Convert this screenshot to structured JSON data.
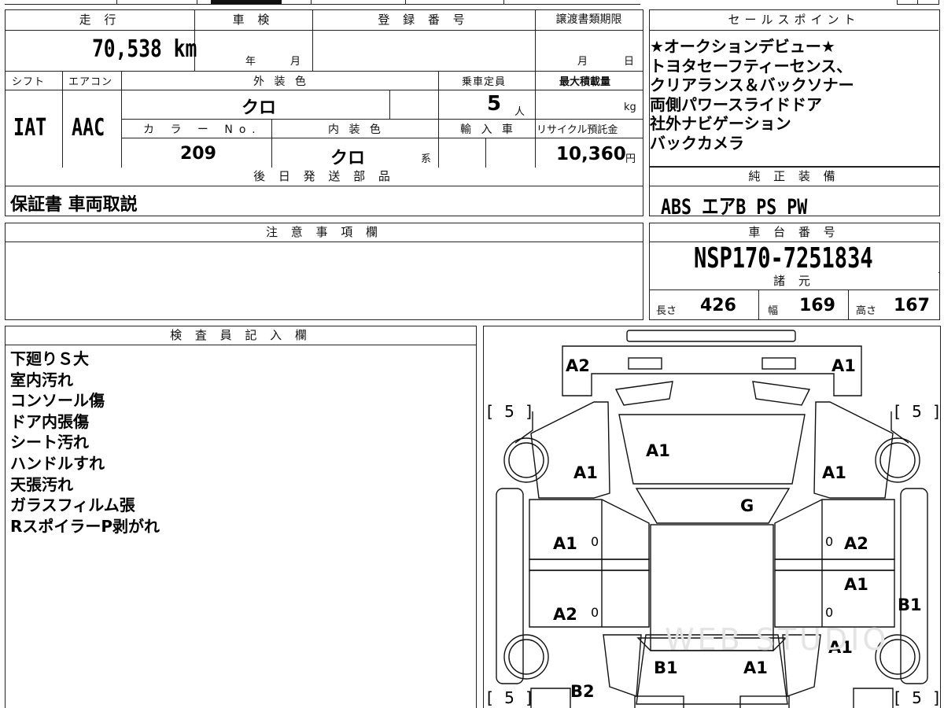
{
  "header": {
    "mileage_label": "走 行",
    "mileage_value": "70,538 km",
    "shaken_label": "車 検",
    "shaken_year": "年",
    "shaken_month": "月",
    "registration_label": "登 録 番 号",
    "transfer_label": "譲渡書類期限",
    "transfer_month": "月",
    "transfer_day": "日",
    "shift_label": "シフト",
    "shift_value": "IAT",
    "aircon_label": "エアコン",
    "aircon_value": "AAC",
    "exterior_label": "外 装 色",
    "exterior_value": "クロ",
    "capacity_label": "乗車定員",
    "capacity_value": "5",
    "capacity_unit": "人",
    "maxload_label": "最大積載量",
    "maxload_unit": "kg",
    "colorno_label": "カ ラ ー No.",
    "colorno_value": "209",
    "interior_label": "内 装 色",
    "interior_value": "クロ",
    "interior_suffix": "系",
    "import_label": "輸 入 車",
    "recycle_label": "リサイクル預託金",
    "recycle_value": "10,360",
    "recycle_unit": "円",
    "later_label": "後 日 発 送 部 品",
    "later_value": "保証書 車両取説"
  },
  "sales": {
    "label": "セールスポイント",
    "lines": [
      "★オークションデビュー★",
      "トヨタセーフティーセンス、",
      "クリアランス＆バックソナー",
      "両側パワースライドドア",
      "社外ナビゲーション",
      "バックカメラ"
    ]
  },
  "equipment": {
    "label": "純 正 装 備",
    "value": "ABS エアB PS PW"
  },
  "caution": {
    "label": "注 意 事 項 欄"
  },
  "chassis": {
    "label": "車 台 番 号",
    "value": "NSP170-7251834",
    "spec_label": "諸 元",
    "length_label": "長さ",
    "length_value": "426",
    "width_label": "幅",
    "width_value": "169",
    "height_label": "高さ",
    "height_value": "167"
  },
  "inspector": {
    "label": "検 査 員 記 入 欄",
    "notes": [
      "下廻りＳ大",
      "室内汚れ",
      "コンソール傷",
      "ドア内張傷",
      "シート汚れ",
      "ハンドルすれ",
      "天張汚れ",
      "ガラスフィルム張",
      "RスポイラーP剥がれ"
    ]
  },
  "diagram": {
    "tire_fl": "[ 5 ]",
    "tire_fr": "[ 5 ]",
    "tire_rl": "[ 5 ]",
    "tire_rr": "[ 5 ]",
    "a2_front_left": "A2",
    "a1_front_right": "A1",
    "a1_hood": "A1",
    "a1_left_fender": "A1",
    "a1_right_fender": "A1",
    "g_windshield": "G",
    "a1_left_front_door": "A1",
    "a2_right_front_door": "A2",
    "a1_right_rear_door": "A1",
    "a2_left_rear_door": "A2",
    "b1_right_side": "B1",
    "a1_right_quarter": "A1",
    "b1_rear_left": "B1",
    "a1_rear_right": "A1",
    "b2_rear": "B2",
    "zero1": "0",
    "zero2": "0",
    "zero3": "0",
    "zero4": "0",
    "watermark": "WEB STUDIO"
  }
}
